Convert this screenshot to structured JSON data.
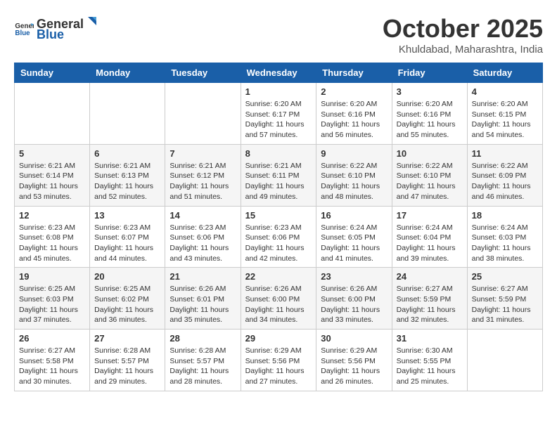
{
  "logo": {
    "text_general": "General",
    "text_blue": "Blue"
  },
  "title": "October 2025",
  "subtitle": "Khuldabad, Maharashtra, India",
  "days_of_week": [
    "Sunday",
    "Monday",
    "Tuesday",
    "Wednesday",
    "Thursday",
    "Friday",
    "Saturday"
  ],
  "weeks": [
    [
      {
        "day": "",
        "info": ""
      },
      {
        "day": "",
        "info": ""
      },
      {
        "day": "",
        "info": ""
      },
      {
        "day": "1",
        "info": "Sunrise: 6:20 AM\nSunset: 6:17 PM\nDaylight: 11 hours\nand 57 minutes."
      },
      {
        "day": "2",
        "info": "Sunrise: 6:20 AM\nSunset: 6:16 PM\nDaylight: 11 hours\nand 56 minutes."
      },
      {
        "day": "3",
        "info": "Sunrise: 6:20 AM\nSunset: 6:16 PM\nDaylight: 11 hours\nand 55 minutes."
      },
      {
        "day": "4",
        "info": "Sunrise: 6:20 AM\nSunset: 6:15 PM\nDaylight: 11 hours\nand 54 minutes."
      }
    ],
    [
      {
        "day": "5",
        "info": "Sunrise: 6:21 AM\nSunset: 6:14 PM\nDaylight: 11 hours\nand 53 minutes."
      },
      {
        "day": "6",
        "info": "Sunrise: 6:21 AM\nSunset: 6:13 PM\nDaylight: 11 hours\nand 52 minutes."
      },
      {
        "day": "7",
        "info": "Sunrise: 6:21 AM\nSunset: 6:12 PM\nDaylight: 11 hours\nand 51 minutes."
      },
      {
        "day": "8",
        "info": "Sunrise: 6:21 AM\nSunset: 6:11 PM\nDaylight: 11 hours\nand 49 minutes."
      },
      {
        "day": "9",
        "info": "Sunrise: 6:22 AM\nSunset: 6:10 PM\nDaylight: 11 hours\nand 48 minutes."
      },
      {
        "day": "10",
        "info": "Sunrise: 6:22 AM\nSunset: 6:10 PM\nDaylight: 11 hours\nand 47 minutes."
      },
      {
        "day": "11",
        "info": "Sunrise: 6:22 AM\nSunset: 6:09 PM\nDaylight: 11 hours\nand 46 minutes."
      }
    ],
    [
      {
        "day": "12",
        "info": "Sunrise: 6:23 AM\nSunset: 6:08 PM\nDaylight: 11 hours\nand 45 minutes."
      },
      {
        "day": "13",
        "info": "Sunrise: 6:23 AM\nSunset: 6:07 PM\nDaylight: 11 hours\nand 44 minutes."
      },
      {
        "day": "14",
        "info": "Sunrise: 6:23 AM\nSunset: 6:06 PM\nDaylight: 11 hours\nand 43 minutes."
      },
      {
        "day": "15",
        "info": "Sunrise: 6:23 AM\nSunset: 6:06 PM\nDaylight: 11 hours\nand 42 minutes."
      },
      {
        "day": "16",
        "info": "Sunrise: 6:24 AM\nSunset: 6:05 PM\nDaylight: 11 hours\nand 41 minutes."
      },
      {
        "day": "17",
        "info": "Sunrise: 6:24 AM\nSunset: 6:04 PM\nDaylight: 11 hours\nand 39 minutes."
      },
      {
        "day": "18",
        "info": "Sunrise: 6:24 AM\nSunset: 6:03 PM\nDaylight: 11 hours\nand 38 minutes."
      }
    ],
    [
      {
        "day": "19",
        "info": "Sunrise: 6:25 AM\nSunset: 6:03 PM\nDaylight: 11 hours\nand 37 minutes."
      },
      {
        "day": "20",
        "info": "Sunrise: 6:25 AM\nSunset: 6:02 PM\nDaylight: 11 hours\nand 36 minutes."
      },
      {
        "day": "21",
        "info": "Sunrise: 6:26 AM\nSunset: 6:01 PM\nDaylight: 11 hours\nand 35 minutes."
      },
      {
        "day": "22",
        "info": "Sunrise: 6:26 AM\nSunset: 6:00 PM\nDaylight: 11 hours\nand 34 minutes."
      },
      {
        "day": "23",
        "info": "Sunrise: 6:26 AM\nSunset: 6:00 PM\nDaylight: 11 hours\nand 33 minutes."
      },
      {
        "day": "24",
        "info": "Sunrise: 6:27 AM\nSunset: 5:59 PM\nDaylight: 11 hours\nand 32 minutes."
      },
      {
        "day": "25",
        "info": "Sunrise: 6:27 AM\nSunset: 5:59 PM\nDaylight: 11 hours\nand 31 minutes."
      }
    ],
    [
      {
        "day": "26",
        "info": "Sunrise: 6:27 AM\nSunset: 5:58 PM\nDaylight: 11 hours\nand 30 minutes."
      },
      {
        "day": "27",
        "info": "Sunrise: 6:28 AM\nSunset: 5:57 PM\nDaylight: 11 hours\nand 29 minutes."
      },
      {
        "day": "28",
        "info": "Sunrise: 6:28 AM\nSunset: 5:57 PM\nDaylight: 11 hours\nand 28 minutes."
      },
      {
        "day": "29",
        "info": "Sunrise: 6:29 AM\nSunset: 5:56 PM\nDaylight: 11 hours\nand 27 minutes."
      },
      {
        "day": "30",
        "info": "Sunrise: 6:29 AM\nSunset: 5:56 PM\nDaylight: 11 hours\nand 26 minutes."
      },
      {
        "day": "31",
        "info": "Sunrise: 6:30 AM\nSunset: 5:55 PM\nDaylight: 11 hours\nand 25 minutes."
      },
      {
        "day": "",
        "info": ""
      }
    ]
  ]
}
